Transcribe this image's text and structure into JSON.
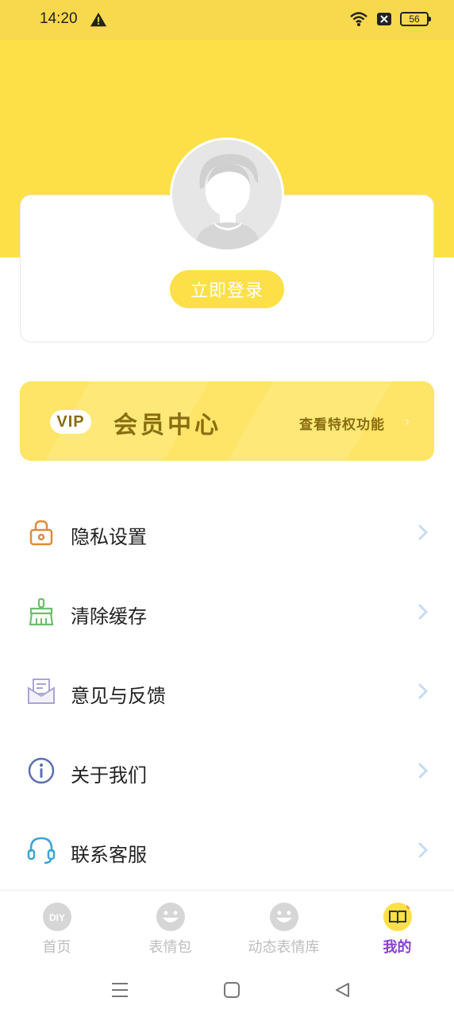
{
  "status_bar": {
    "time": "14:20",
    "battery": "56",
    "icons": [
      "warning-icon",
      "wifi-icon",
      "no-sim-icon",
      "battery-icon"
    ]
  },
  "profile": {
    "login_button": "立即登录"
  },
  "vip": {
    "badge": "VIP",
    "title": "会员中心",
    "link": "查看特权功能"
  },
  "menu": {
    "items": [
      {
        "label": "隐私设置",
        "icon": "lock-icon",
        "color": "#e08a3a"
      },
      {
        "label": "清除缓存",
        "icon": "broom-icon",
        "color": "#6cbf6c"
      },
      {
        "label": "意见与反馈",
        "icon": "mail-icon",
        "color": "#a9a4d6"
      },
      {
        "label": "关于我们",
        "icon": "info-icon",
        "color": "#5a6fb0"
      },
      {
        "label": "联系客服",
        "icon": "headset-icon",
        "color": "#3aa3d6"
      }
    ]
  },
  "tabs": [
    {
      "label": "首页",
      "icon": "diy-icon",
      "active": false
    },
    {
      "label": "表情包",
      "icon": "smile-icon",
      "active": false
    },
    {
      "label": "动态表情库",
      "icon": "smile-icon",
      "active": false
    },
    {
      "label": "我的",
      "icon": "book-icon",
      "active": true
    }
  ],
  "colors": {
    "header_yellow": "#fde047",
    "status_yellow": "#f8d94e",
    "vip_text": "#8a6d10",
    "active_tab": "#8a3fd6",
    "chevron": "#c4dcf5"
  }
}
